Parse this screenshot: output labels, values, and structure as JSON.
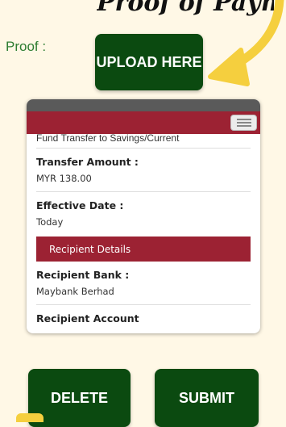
{
  "heading": "Proof of Payment",
  "proof_label": "Proof :",
  "upload_button": "UPLOAD HERE",
  "app": {
    "cut_row": "Fund Transfer to Savings/Current",
    "fields": [
      {
        "label": "Transfer Amount :",
        "value": "MYR 138.00"
      },
      {
        "label": "Effective Date :",
        "value": "Today"
      }
    ],
    "section": "Recipient Details",
    "recipient_bank": {
      "label": "Recipient Bank :",
      "value": "Maybank Berhad"
    },
    "recipient_account": {
      "label": "Recipient Account"
    }
  },
  "actions": {
    "delete": "DELETE",
    "submit": "SUBMIT"
  },
  "colors": {
    "button_green": "#0b4a10",
    "accent_red": "#9c2233",
    "arrow_yellow": "#f5cf3e"
  },
  "icons": {
    "arrow": "arrow-icon",
    "menu": "menu-icon"
  }
}
